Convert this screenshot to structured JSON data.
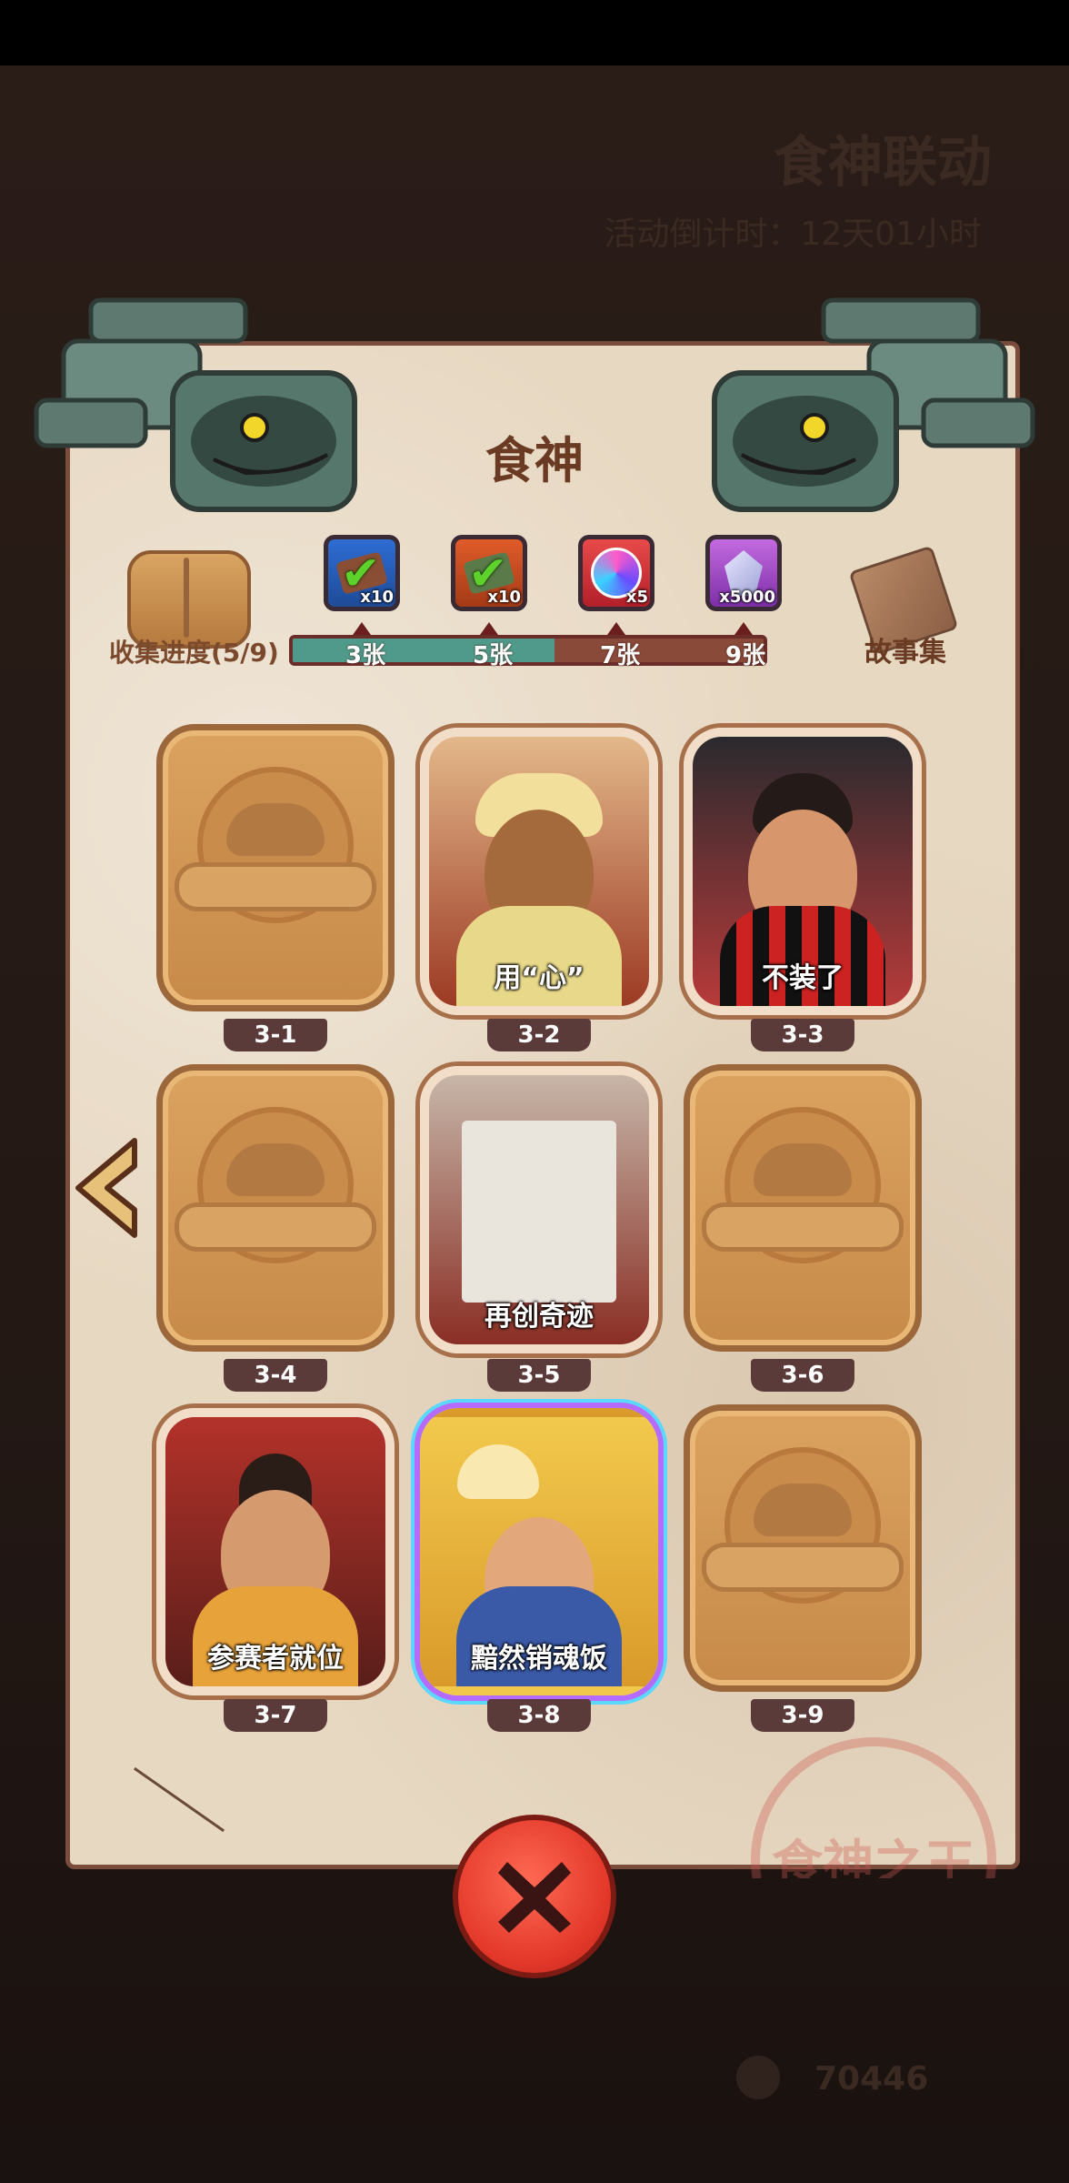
{
  "background": {
    "event_title": "食神联动",
    "countdown": "活动倒计时：12天01小时",
    "currency_amount": "70446"
  },
  "dialog": {
    "title": "食神",
    "progress_label": "收集进度(5/9)",
    "storybook_label": "故事集",
    "progress_fraction": 0.556,
    "seal_text": "食神之王"
  },
  "rewards": [
    {
      "icon": "ticket-icon",
      "qty": "x10",
      "claimed": true,
      "threshold": "3张"
    },
    {
      "icon": "ticket-icon",
      "qty": "x10",
      "claimed": true,
      "threshold": "5张"
    },
    {
      "icon": "disc-icon",
      "qty": "x5",
      "claimed": false,
      "threshold": "7张"
    },
    {
      "icon": "gem-icon",
      "qty": "x5000",
      "claimed": false,
      "threshold": "9张"
    }
  ],
  "cards": [
    {
      "id": "3-1",
      "caption": "",
      "state": "locked"
    },
    {
      "id": "3-2",
      "caption": "用“心”",
      "state": "unlocked"
    },
    {
      "id": "3-3",
      "caption": "不装了",
      "state": "unlocked"
    },
    {
      "id": "3-4",
      "caption": "",
      "state": "locked"
    },
    {
      "id": "3-5",
      "caption": "再创奇迹",
      "state": "unlocked"
    },
    {
      "id": "3-6",
      "caption": "",
      "state": "locked"
    },
    {
      "id": "3-7",
      "caption": "参赛者就位",
      "state": "unlocked"
    },
    {
      "id": "3-8",
      "caption": "黯然销魂饭",
      "state": "rare"
    },
    {
      "id": "3-9",
      "caption": "",
      "state": "locked"
    }
  ],
  "colors": {
    "paper": "#e7d8c2",
    "title": "#6a3a22",
    "close_button": "#e3382a",
    "bar_fill": "#4f9a8a"
  }
}
